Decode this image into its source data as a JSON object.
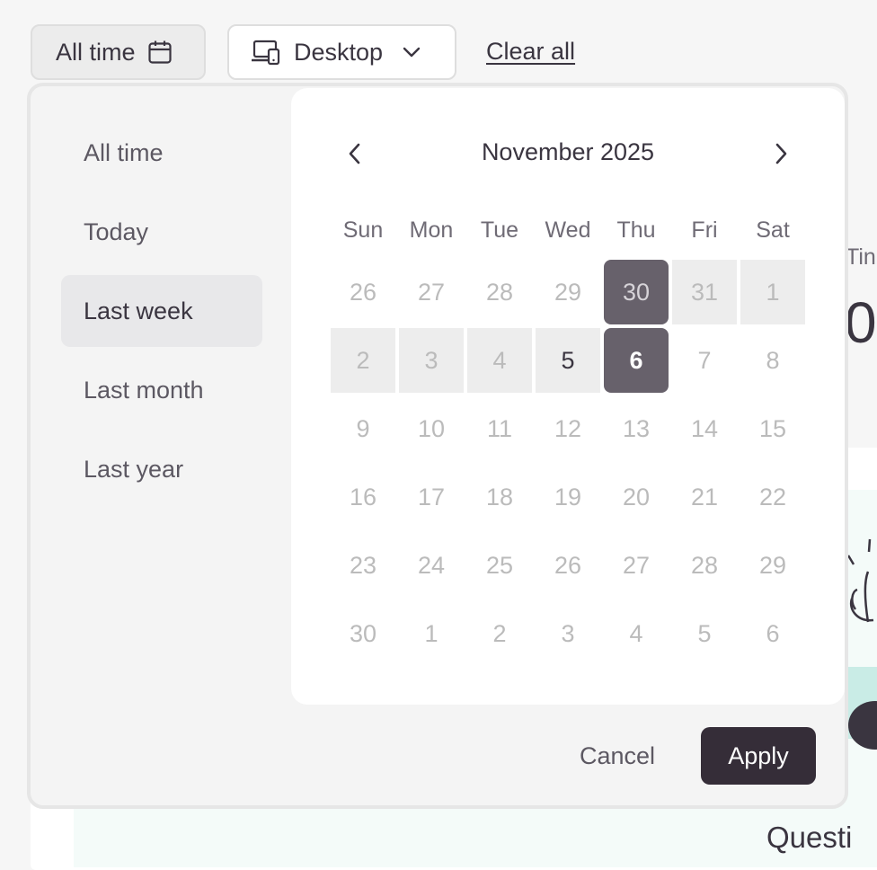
{
  "toolbar": {
    "date_button_label": "All time",
    "device_select_value": "Desktop",
    "clear_all_label": "Clear all"
  },
  "background": {
    "stat_label_partial": "Tin",
    "stat_value_partial": "0",
    "section_title_partial": "Questi"
  },
  "presets": [
    {
      "label": "All time",
      "selected": false
    },
    {
      "label": "Today",
      "selected": false
    },
    {
      "label": "Last week",
      "selected": true
    },
    {
      "label": "Last month",
      "selected": false
    },
    {
      "label": "Last year",
      "selected": false
    }
  ],
  "calendar": {
    "month_label": "November 2025",
    "weekdays": [
      "Sun",
      "Mon",
      "Tue",
      "Wed",
      "Thu",
      "Fri",
      "Sat"
    ],
    "weeks": [
      [
        "26",
        "27",
        "28",
        "29",
        "30",
        "31",
        "1"
      ],
      [
        "2",
        "3",
        "4",
        "5",
        "6",
        "7",
        "8"
      ],
      [
        "9",
        "10",
        "11",
        "12",
        "13",
        "14",
        "15"
      ],
      [
        "16",
        "17",
        "18",
        "19",
        "20",
        "21",
        "22"
      ],
      [
        "23",
        "24",
        "25",
        "26",
        "27",
        "28",
        "29"
      ],
      [
        "30",
        "1",
        "2",
        "3",
        "4",
        "5",
        "6"
      ]
    ],
    "range_start": "October 30",
    "range_end": "November 6"
  },
  "actions": {
    "cancel_label": "Cancel",
    "apply_label": "Apply"
  },
  "colors": {
    "accent_dark": "#352d38",
    "range_edge": "#67616b",
    "range_fill": "#ededed"
  },
  "icons": {
    "date_button": "calendar-icon",
    "device_select": "devices-icon",
    "device_chevron": "chevron-down-icon",
    "prev_month": "chevron-left-icon",
    "next_month": "chevron-right-icon"
  }
}
